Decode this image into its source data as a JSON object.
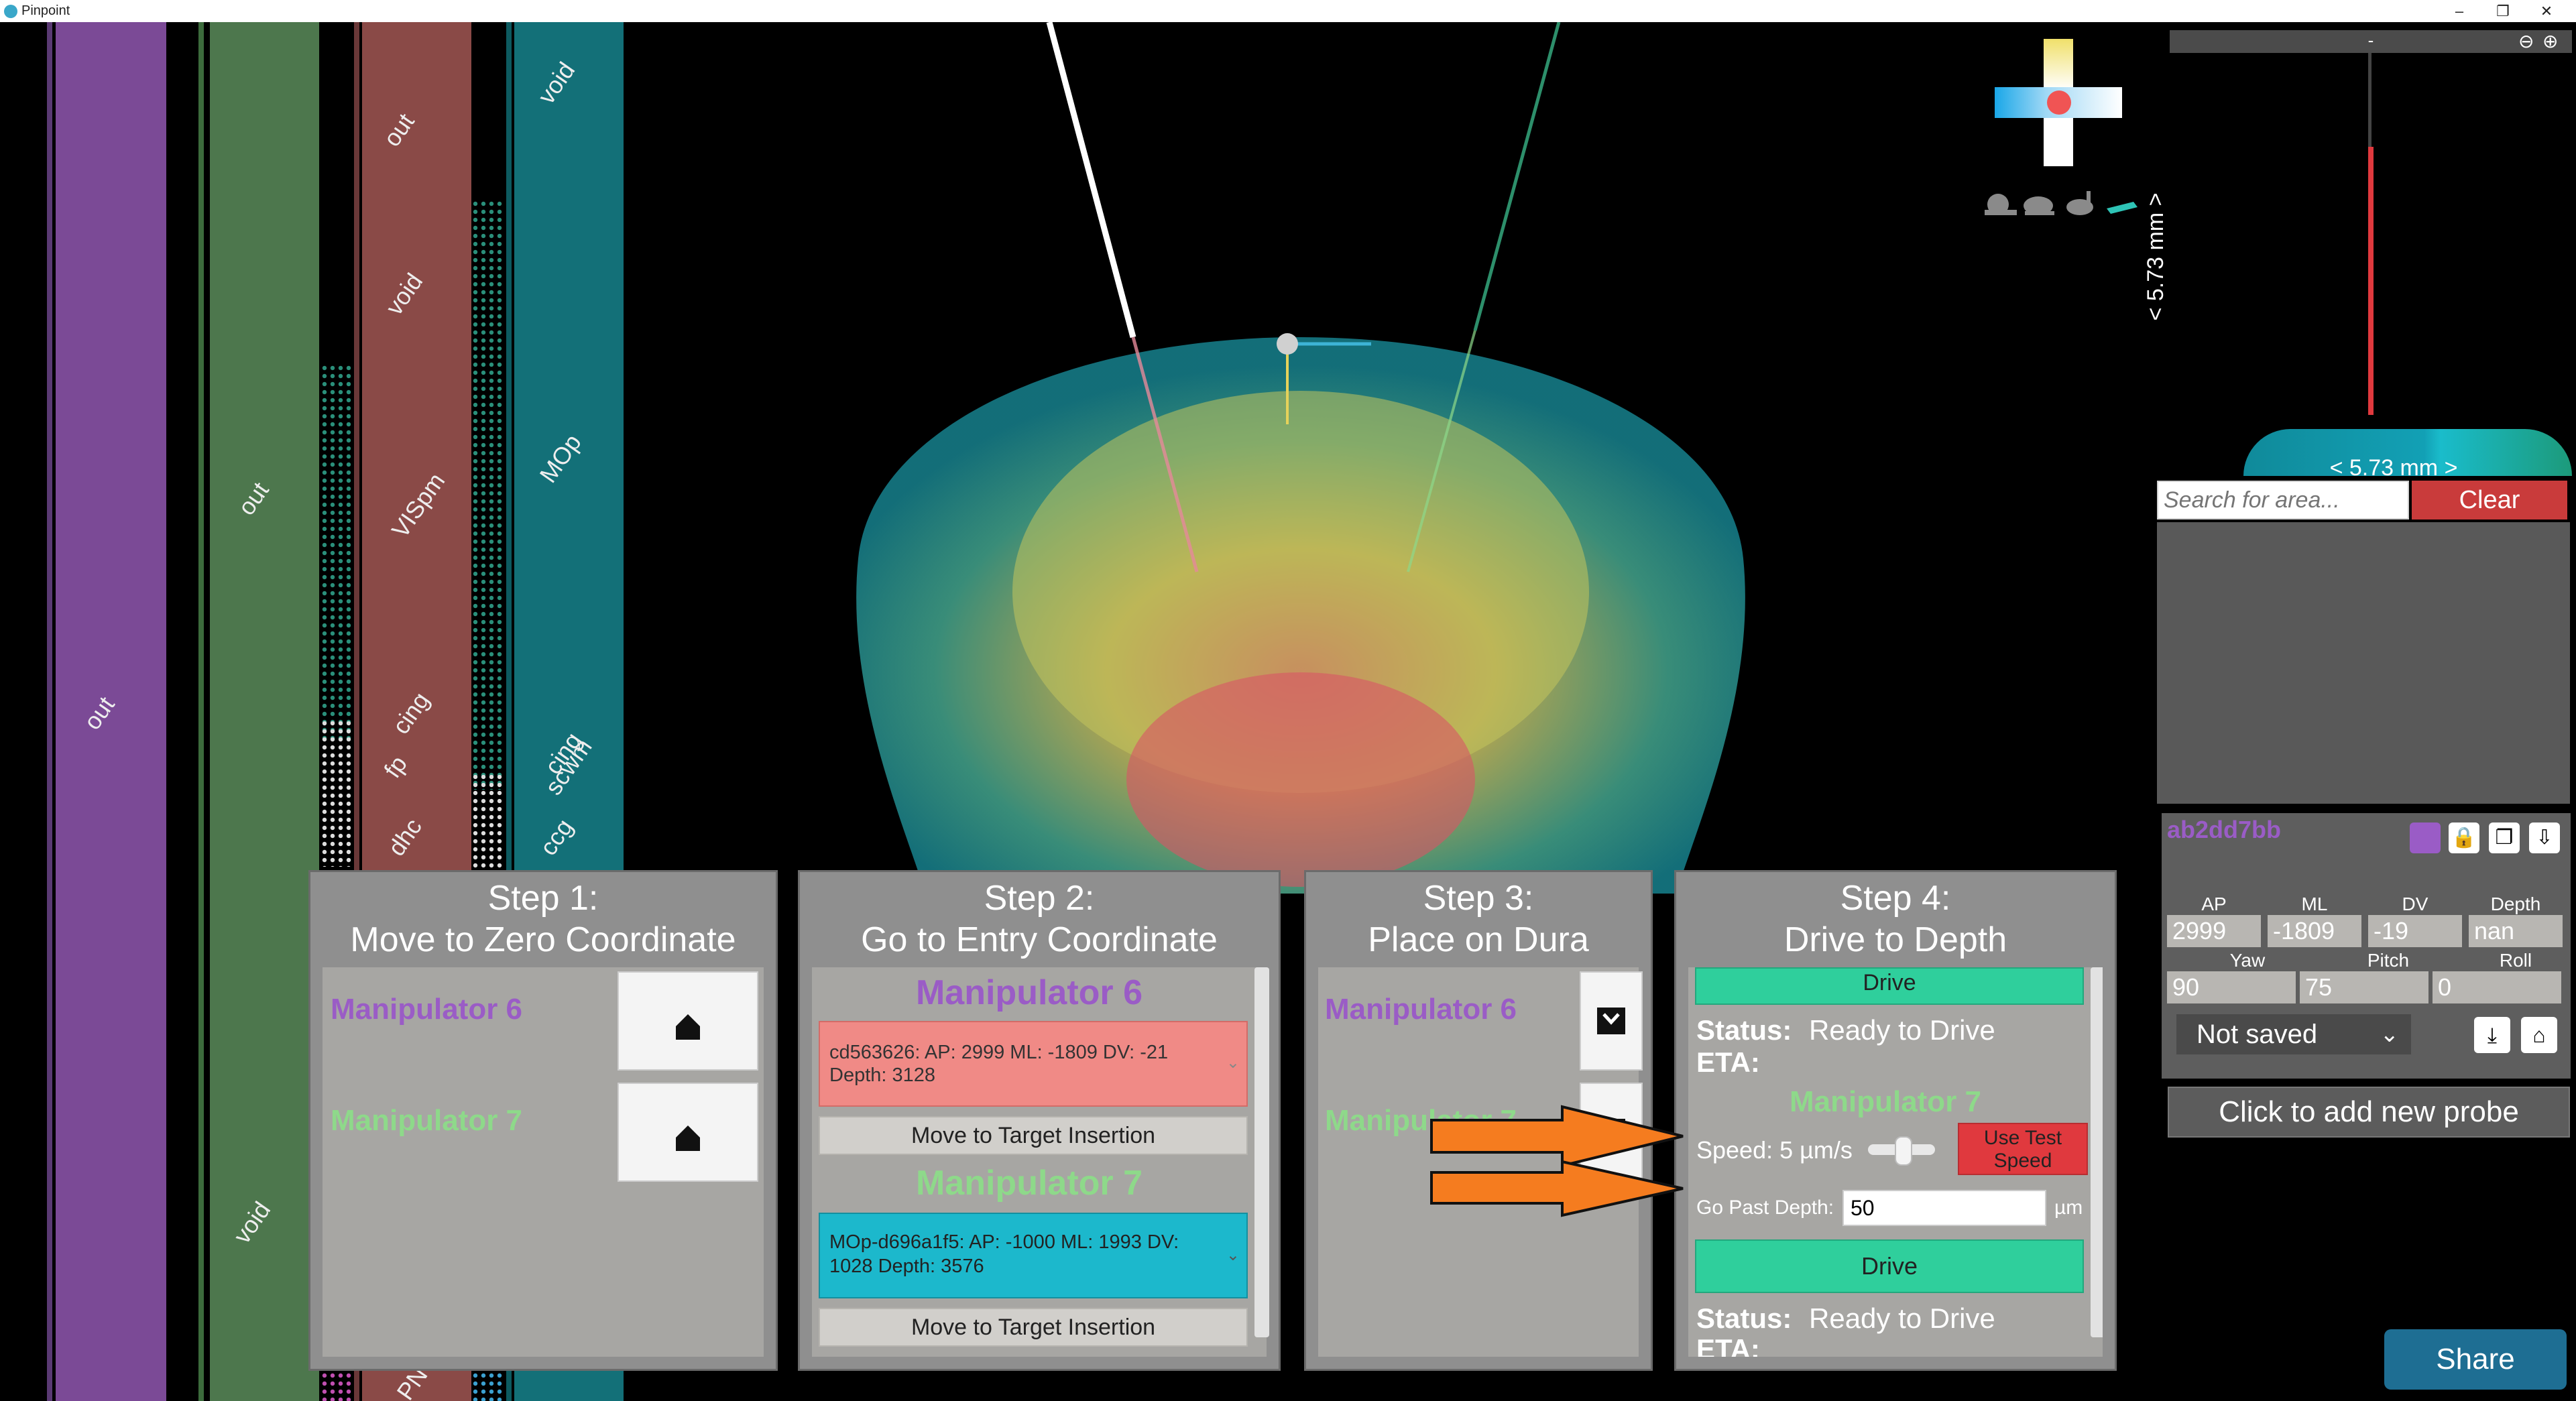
{
  "window": {
    "title": "Pinpoint",
    "minimize": "–",
    "restore": "❐",
    "close": "✕"
  },
  "strips": {
    "s1": {
      "label": "out"
    },
    "s2": {
      "label_top": "out",
      "label_bottom": "void"
    },
    "s3": {
      "labels": [
        "out",
        "void",
        "VISpm",
        "cing",
        "fp",
        "dhc",
        "PN"
      ]
    },
    "s4": {
      "labels": [
        "void",
        "MOp",
        "cing",
        "scwm",
        "ccg"
      ]
    }
  },
  "nav": {
    "speed_icons": [
      "snail-icon",
      "turtle-icon",
      "rabbit-icon",
      "cheetah-icon"
    ],
    "scale_vertical": "< 5.73 mm >",
    "scale_horizontal": "< 5.73 mm >",
    "top_bar_label": "-"
  },
  "search": {
    "placeholder": "Search for area...",
    "clear_label": "Clear"
  },
  "probe": {
    "id": "ab2dd7bb",
    "color": "#9a5cc6",
    "labels": {
      "ap": "AP",
      "ml": "ML",
      "dv": "DV",
      "depth": "Depth",
      "yaw": "Yaw",
      "pitch": "Pitch",
      "roll": "Roll"
    },
    "values": {
      "ap": "2999",
      "ml": "-1809",
      "dv": "-19",
      "depth": "nan",
      "yaw": "90",
      "pitch": "75",
      "roll": "0"
    },
    "save_state": "Not saved",
    "add_new_label": "Click to add new probe"
  },
  "share_label": "Share",
  "steps": {
    "step1": {
      "title_line1": "Step 1:",
      "title_line2": "Move to Zero Coordinate",
      "manip_a": "Manipulator 6",
      "manip_b": "Manipulator 7"
    },
    "step2": {
      "title_line1": "Step 2:",
      "title_line2": "Go to Entry Coordinate",
      "manip_a": "Manipulator 6",
      "manip_a_target": "cd563626: AP: 2999 ML: -1809 DV: -21 Depth: 3128",
      "move_label_a": "Move to Target Insertion",
      "manip_b": "Manipulator 7",
      "manip_b_target": "MOp-d696a1f5: AP: -1000 ML: 1993 DV: 1028 Depth: 3576",
      "move_label_b": "Move to Target Insertion"
    },
    "step3": {
      "title_line1": "Step 3:",
      "title_line2": "Place on Dura",
      "manip_a": "Manipulator 6",
      "manip_b": "Manipulator 7"
    },
    "step4": {
      "title_line1": "Step 4:",
      "title_line2": "Drive to Depth",
      "drive_top": "Drive",
      "status_label": "Status:",
      "status_value": "Ready to Drive",
      "eta_label": "ETA:",
      "manip_b": "Manipulator 7",
      "speed_label": "Speed: 5 µm/s",
      "test_speed_label": "Use Test Speed",
      "go_past_label": "Go Past Depth:",
      "go_past_value": "50",
      "unit": "µm",
      "drive_label": "Drive",
      "status_label_2": "Status:",
      "status_value_2": "Ready to Drive",
      "eta_label_2": "ETA:"
    }
  },
  "colors": {
    "accent_red": "#e0393e",
    "drive_green": "#2fcf9c",
    "target_red": "#f08a86",
    "target_cyan": "#1cb8cc",
    "share_blue": "#1e6e93",
    "clear_red": "#c93b3b",
    "arrow_orange": "#f57c1f"
  }
}
